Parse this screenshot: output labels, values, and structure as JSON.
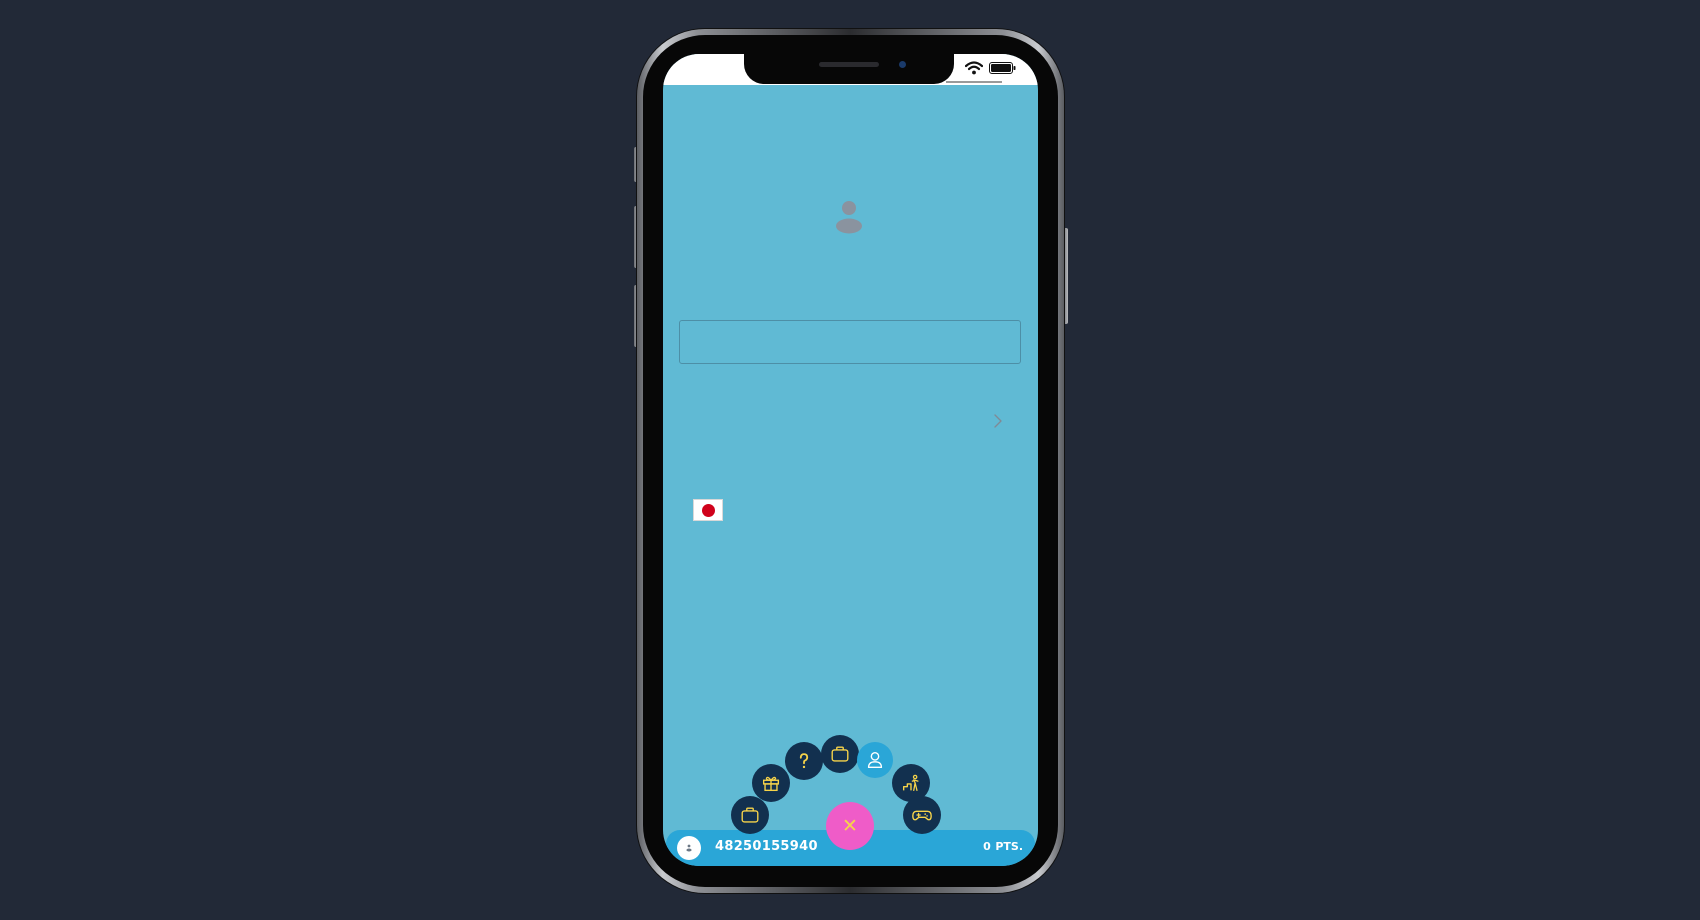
{
  "status_bar": {
    "wifi_icon": "wifi-icon",
    "battery_icon": "battery-icon"
  },
  "profile": {
    "avatar_icon": "user-silhouette-icon",
    "input_value": "",
    "input_placeholder": "",
    "chevron_icon": "chevron-right-icon",
    "language_flag": "japan-flag-icon"
  },
  "radial_menu": {
    "items": [
      {
        "icon": "briefcase-icon",
        "active": false
      },
      {
        "icon": "gift-icon",
        "active": false
      },
      {
        "icon": "question-icon",
        "active": false
      },
      {
        "icon": "briefcase-icon",
        "active": false
      },
      {
        "icon": "user-icon",
        "active": true
      },
      {
        "icon": "ranking-icon",
        "active": false
      },
      {
        "icon": "gamepad-icon",
        "active": false
      }
    ],
    "close_label": "✕"
  },
  "bottom_bar": {
    "user_id": "48250155940",
    "points_value": "0",
    "points_unit": "PTS."
  },
  "colors": {
    "page_background": "#222937",
    "screen_background": "#60bad4",
    "bottom_bar": "#2aa6d7",
    "menu_button": "#12304f",
    "menu_icon": "#f6d34a",
    "close_button": "#ef5cc8"
  }
}
